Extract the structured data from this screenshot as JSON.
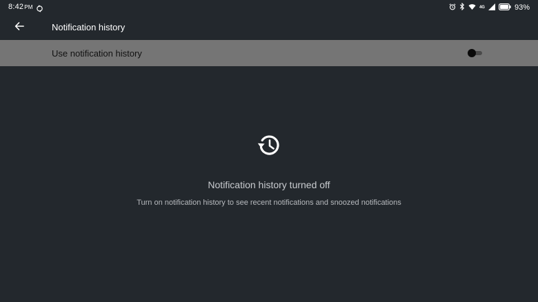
{
  "status_bar": {
    "time": "8:42",
    "ampm": "PM",
    "network": "4G",
    "battery": "93%"
  },
  "app_bar": {
    "title": "Notification history"
  },
  "setting": {
    "label": "Use notification history",
    "enabled": false
  },
  "empty_state": {
    "title": "Notification history turned off",
    "description": "Turn on notification history to see recent notifications and snoozed notifications"
  },
  "icons": {
    "back": "arrow-back-icon",
    "history": "history-icon",
    "alarm": "alarm-icon",
    "bluetooth": "bluetooth-icon",
    "wifi": "wifi-icon",
    "signal": "signal-icon",
    "battery": "battery-icon",
    "sync": "sync-icon"
  }
}
